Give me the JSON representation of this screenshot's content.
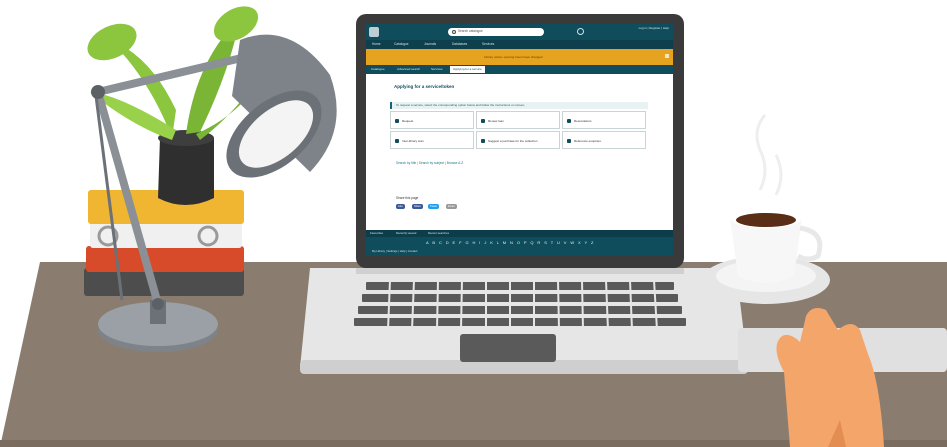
{
  "header": {
    "search_placeholder": "Search catalogue",
    "user_links": "Log in  |  Register  |  Help"
  },
  "nav": {
    "items": [
      "Home",
      "Catalogue",
      "Journals",
      "Databases",
      "Services"
    ]
  },
  "banner": {
    "text": "Library notice: opening hours have changed"
  },
  "tabs": {
    "items": [
      "Catalogue",
      "Advanced search",
      "Services",
      "Applying for a service"
    ]
  },
  "main": {
    "title": "Applying for a service/token",
    "info": "To request a service, select the corresponding option below and follow the instructions on screen.",
    "cards": [
      "Request",
      "Renew loan",
      "Reservations",
      "Inter-library loan",
      "Suggest a purchase for the collection",
      "Reference enquiries"
    ],
    "links": "Search by title  |  Search by subject  |  Browse A-Z",
    "footer_head": "Share this page",
    "footer_buttons": [
      "Like",
      "Share",
      "Tweet",
      "Email"
    ]
  },
  "taskbar": {
    "tabs": [
      "Favourites",
      "Recently viewed",
      "Recent searches"
    ],
    "alphabet": "A B C D E F G H I J K L M N O P Q R S T U V W X Y Z",
    "row": "My Library  |  Settings  |  Help  |  Contact"
  },
  "colors": {
    "teal": "#0f4c5c",
    "banner": "#e6a31f",
    "desk": "#8b7e70",
    "lamp": "#7d8389"
  }
}
